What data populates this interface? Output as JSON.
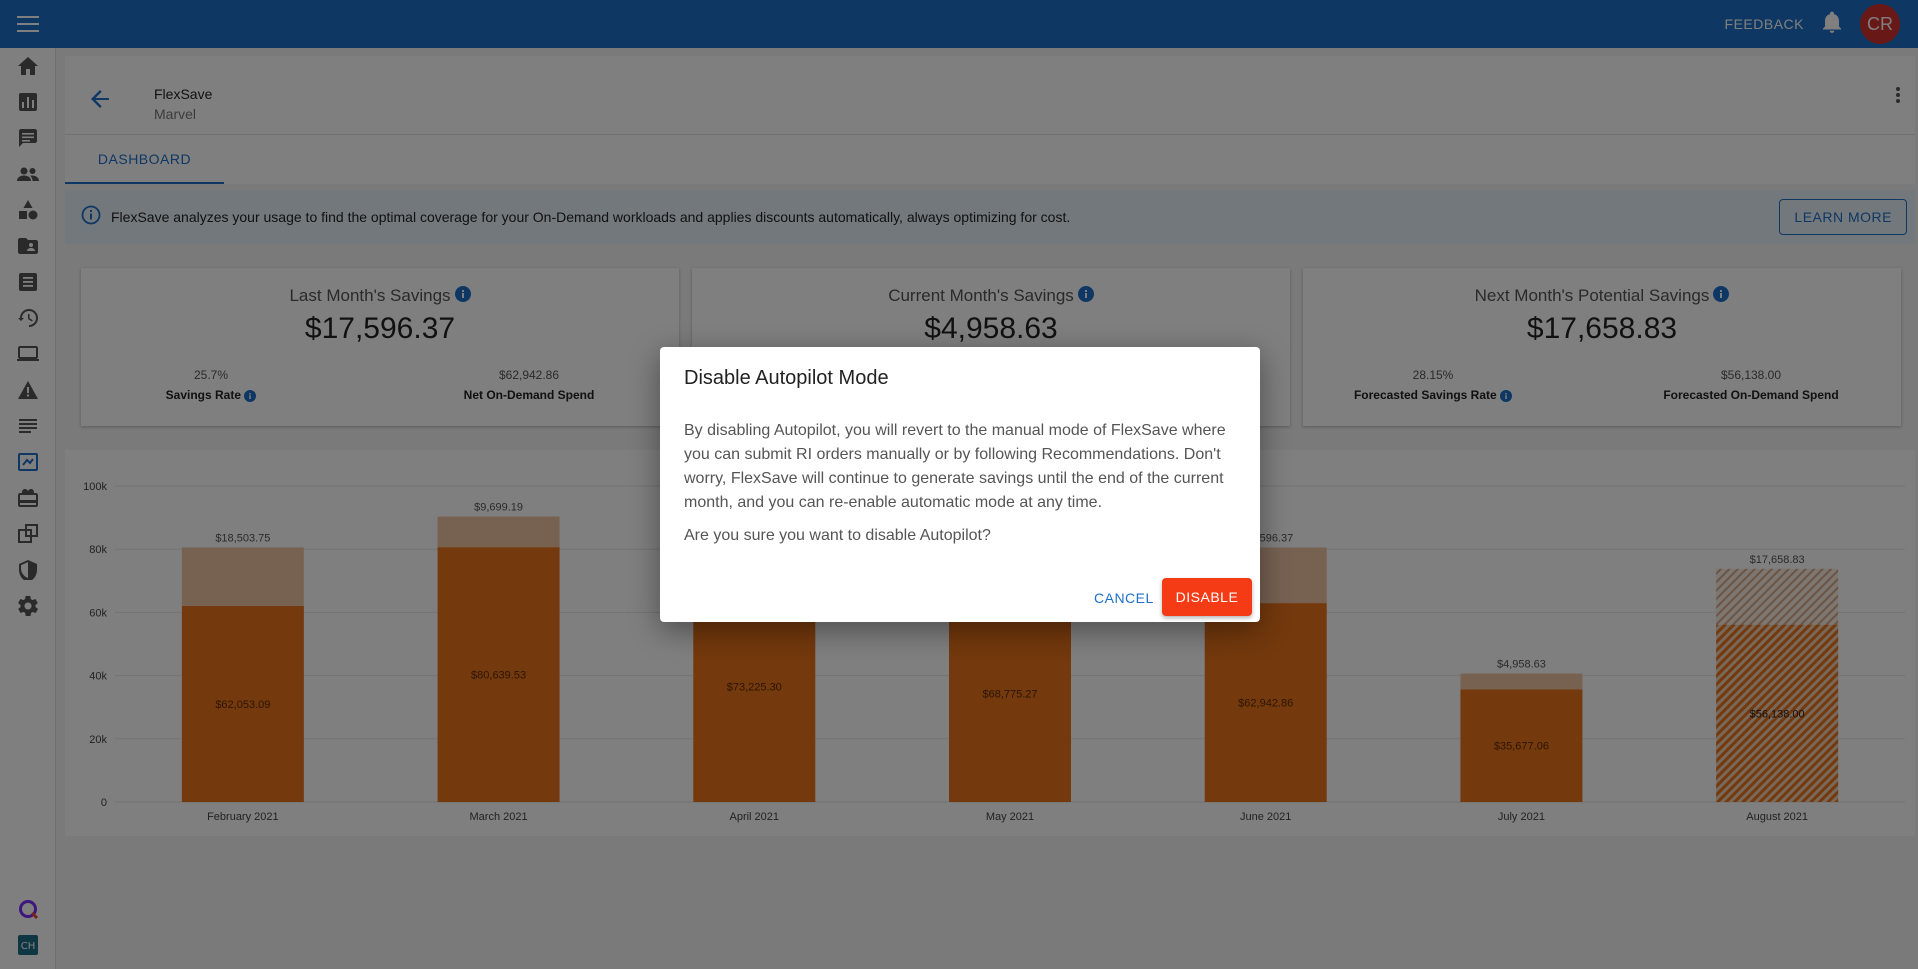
{
  "topbar": {
    "feedback_label": "FEEDBACK",
    "avatar_initials": "CR",
    "brand_color": "#1e6fc7"
  },
  "header": {
    "title": "FlexSave",
    "subtitle": "Marvel",
    "tab_label": "DASHBOARD"
  },
  "banner": {
    "text": "FlexSave analyzes your usage to find the optimal coverage for your On-Demand workloads and applies discounts automatically, always optimizing for cost.",
    "button_label": "LEARN MORE"
  },
  "cards": [
    {
      "title": "Last Month's Savings",
      "amount": "$17,596.37",
      "left_value": "25.7%",
      "left_label": "Savings Rate",
      "right_value": "$62,942.86",
      "right_label": "Net On-Demand Spend"
    },
    {
      "title": "Current Month's Savings",
      "amount": "$4,958.63",
      "left_value": "",
      "left_label": "",
      "right_value": "",
      "right_label": ""
    },
    {
      "title": "Next Month's Potential Savings",
      "amount": "$17,658.83",
      "left_value": "28.15%",
      "left_label": "Forecasted Savings Rate",
      "right_value": "$56,138.00",
      "right_label": "Forecasted On-Demand Spend"
    }
  ],
  "chart_data": {
    "type": "bar",
    "stacked": true,
    "categories": [
      "February 2021",
      "March 2021",
      "April 2021",
      "May 2021",
      "June 2021",
      "July 2021",
      "August 2021"
    ],
    "series": [
      {
        "values": [
          62053.09,
          80639.53,
          73225.3,
          68775.27,
          62942.86,
          35677.06,
          56138.0
        ],
        "labels": [
          "$62,053.09",
          "$80,639.53",
          "$73,225.30",
          "$68,775.27",
          "$62,942.86",
          "$35,677.06",
          "$56,138.00"
        ]
      },
      {
        "values": [
          18503.75,
          9699.19,
          null,
          null,
          17596.37,
          4958.63,
          17658.83
        ],
        "labels": [
          "$18,503.75",
          "$9,699.19",
          "",
          "",
          "$17,596.37",
          "$4,958.63",
          "$17,658.83"
        ]
      }
    ],
    "y_ticks": [
      "0",
      "20k",
      "40k",
      "60k",
      "80k",
      "100k"
    ],
    "ylim": [
      0,
      100000
    ],
    "forecast_category": "August 2021",
    "colors": {
      "base": "#e8731a",
      "savings": "#eec5a4"
    }
  },
  "dialog": {
    "title": "Disable Autopilot Mode",
    "body": "By disabling Autopilot, you will revert to the manual mode of FlexSave where you can submit RI orders manually or by following Recommendations. Don't worry, FlexSave will continue to generate savings until the end of the current month, and you can re-enable automatic mode at any time.",
    "question": "Are you sure you want to disable Autopilot?",
    "cancel_label": "CANCEL",
    "confirm_label": "DISABLE",
    "confirm_color": "#f43b16"
  }
}
